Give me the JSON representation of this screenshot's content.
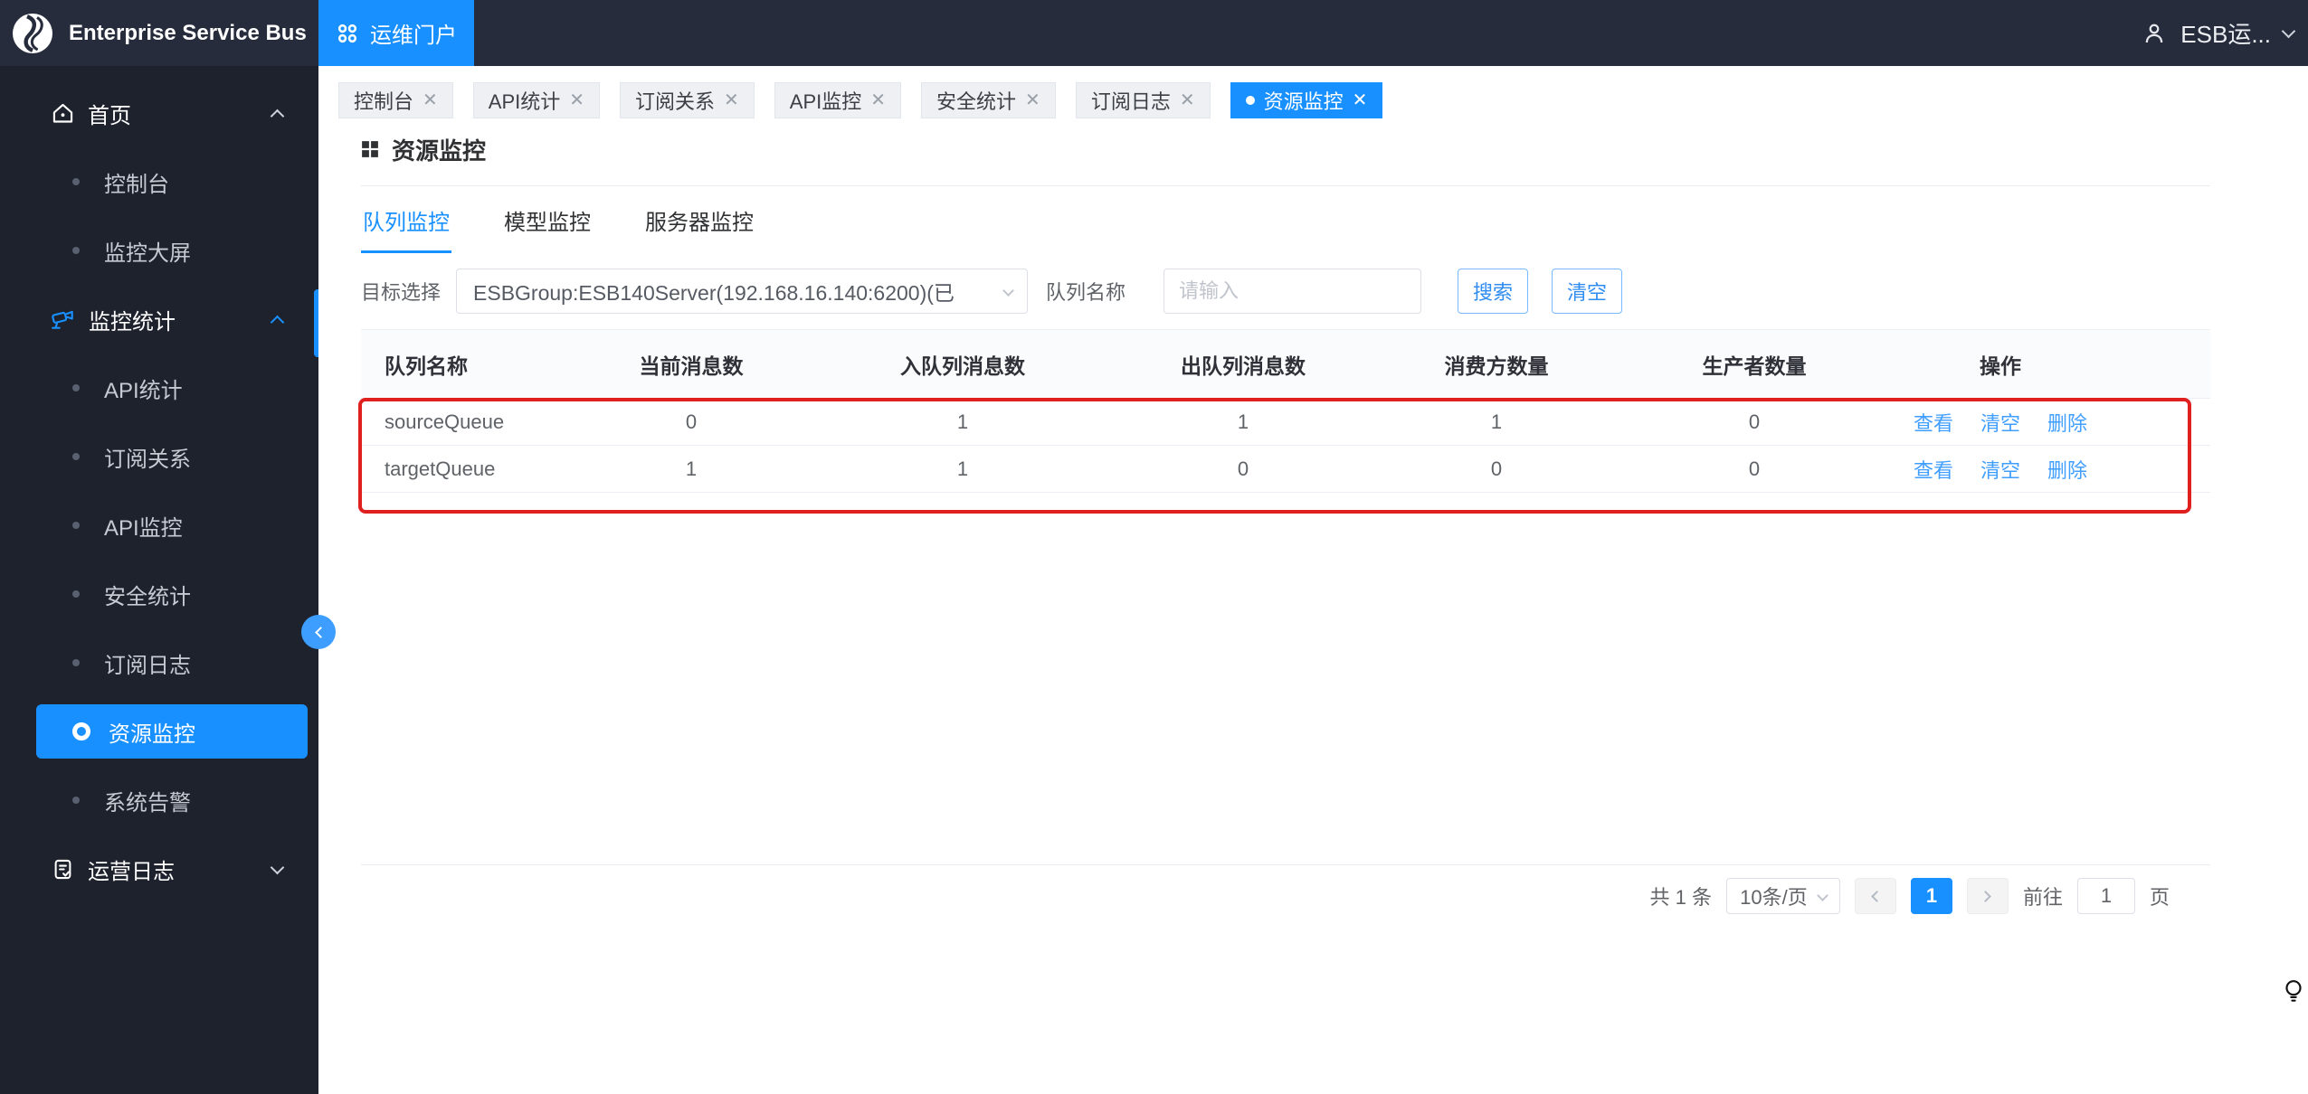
{
  "topbar": {
    "brand": "Enterprise Service Bus",
    "portal_label": "运维门户",
    "user_name": "ESB运..."
  },
  "sidebar": {
    "menu": [
      {
        "label": "首页"
      },
      {
        "label": "控制台"
      },
      {
        "label": "监控大屏"
      },
      {
        "label": "监控统计"
      },
      {
        "label": "API统计"
      },
      {
        "label": "订阅关系"
      },
      {
        "label": "API监控"
      },
      {
        "label": "安全统计"
      },
      {
        "label": "订阅日志"
      },
      {
        "label": "资源监控"
      },
      {
        "label": "系统告警"
      },
      {
        "label": "运营日志"
      }
    ],
    "active_item": "资源监控"
  },
  "tabbar": {
    "items": [
      {
        "label": "控制台"
      },
      {
        "label": "API统计"
      },
      {
        "label": "订阅关系"
      },
      {
        "label": "API监控"
      },
      {
        "label": "安全统计"
      },
      {
        "label": "订阅日志"
      },
      {
        "label": "资源监控"
      }
    ],
    "active_index": 6
  },
  "page": {
    "title": "资源监控"
  },
  "subtabs": {
    "items": [
      "队列监控",
      "模型监控",
      "服务器监控"
    ],
    "active_index": 0
  },
  "filter": {
    "target_label": "目标选择",
    "target_value": "ESBGroup:ESB140Server(192.168.16.140:6200)(已",
    "queue_label": "队列名称",
    "queue_placeholder": "请输入",
    "search_label": "搜索",
    "clear_label": "清空"
  },
  "table": {
    "headers": [
      "队列名称",
      "当前消息数",
      "入队列消息数",
      "出队列消息数",
      "消费方数量",
      "生产者数量",
      "操作"
    ],
    "rows": [
      {
        "name": "sourceQueue",
        "current": "0",
        "enqueued": "1",
        "dequeued": "1",
        "consumers": "1",
        "producers": "0"
      },
      {
        "name": "targetQueue",
        "current": "1",
        "enqueued": "1",
        "dequeued": "0",
        "consumers": "0",
        "producers": "0"
      }
    ],
    "actions": {
      "view": "查看",
      "clear": "清空",
      "delete": "删除"
    }
  },
  "pagination": {
    "total_text": "共 1 条",
    "page_size": "10条/页",
    "current_page": "1",
    "goto_label": "前往",
    "goto_value": "1",
    "page_unit": "页"
  },
  "colors": {
    "accent": "#1890ff",
    "link": "#409eff",
    "annotation_red": "#e01f1f",
    "topbar_bg": "#262c3b",
    "sidebar_bg": "#1e222d"
  }
}
